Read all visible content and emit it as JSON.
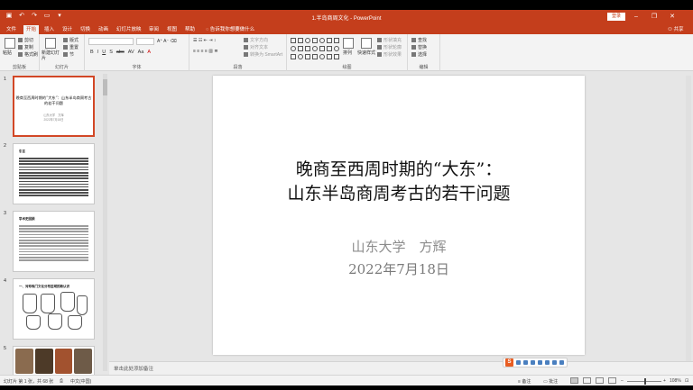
{
  "titlebar": {
    "doc_title": "1.半岛商周文化 - PowerPoint",
    "login_label": "登录",
    "quick_access": [
      "save-icon",
      "undo-icon",
      "redo-icon",
      "present-icon"
    ],
    "window_buttons": [
      "minimize-icon",
      "restore-icon",
      "close-icon"
    ],
    "accent_color": "#c43e1c"
  },
  "tabs": {
    "items": [
      "文件",
      "开始",
      "插入",
      "设计",
      "切换",
      "动画",
      "幻灯片放映",
      "审阅",
      "视图",
      "帮助"
    ],
    "active_index": 1,
    "tell_me": "告诉我你想要做什么",
    "share": "共享"
  },
  "ribbon": {
    "clipboard": {
      "label": "剪贴板",
      "paste": "粘贴",
      "cut": "剪切",
      "copy": "复制",
      "format_painter": "格式刷"
    },
    "slides": {
      "label": "幻灯片",
      "new_slide": "新建幻灯片",
      "layout": "版式",
      "reset": "重置",
      "section": "节"
    },
    "font": {
      "label": "字体",
      "buttons": [
        "B",
        "I",
        "U",
        "S",
        "abc",
        "AV",
        "Aa",
        "A"
      ]
    },
    "paragraph": {
      "label": "段落",
      "text_direction": "文字方向",
      "align_text": "对齐文本",
      "smartart": "转换为 SmartArt"
    },
    "drawing": {
      "label": "绘图",
      "arrange": "排列",
      "quick_styles": "快速样式",
      "shape_fill": "形状填充",
      "shape_outline": "形状轮廓",
      "shape_effects": "形状效果"
    },
    "editing": {
      "label": "编辑",
      "find": "查找",
      "replace": "替换",
      "select": "选择"
    }
  },
  "thumbnails": [
    {
      "number": "1",
      "title": "晚商至西周时期的“大东”：山东半岛商周考古的若干问题",
      "sub": [
        "山东大学　方辉",
        "2022年7月18日"
      ],
      "selected": true
    },
    {
      "number": "2",
      "heading": "引言"
    },
    {
      "number": "3",
      "heading": "学术史回顾"
    },
    {
      "number": "4",
      "heading": "一、对珍珠门文化分布区域的新认识"
    },
    {
      "number": "5"
    }
  ],
  "slide": {
    "title_line1": "晚商至西周时期的“大东”：",
    "title_line2": "山东半岛商周考古的若干问题",
    "author": "山东大学　方辉",
    "date": "2022年7月18日"
  },
  "notes_placeholder": "单击此处添加备注",
  "status": {
    "slide_info": "幻灯片 第 1 张，共 68 张",
    "language": "中文(中国)",
    "notes_label": "备注",
    "comments_label": "批注",
    "zoom": "108%"
  }
}
